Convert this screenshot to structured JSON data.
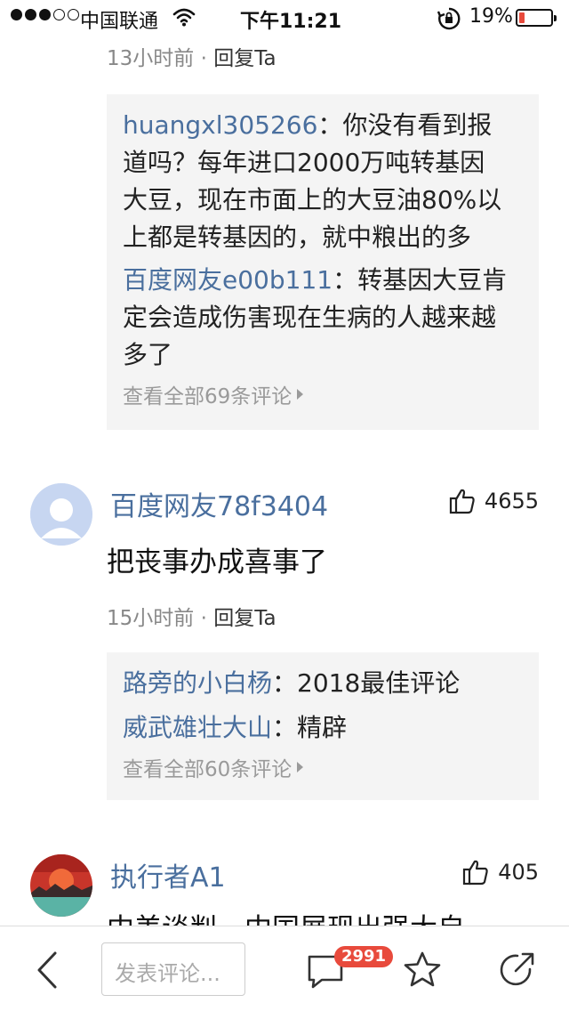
{
  "status_bar": {
    "carrier": "中国联通",
    "time": "下午11:21",
    "battery_percent": "19%",
    "battery_level": 0.19,
    "signal_bars_filled": 3,
    "signal_bars_total": 5
  },
  "colors": {
    "username": "#4a6f9e",
    "badge": "#e84a3c",
    "reply_box_bg": "#f4f4f4"
  },
  "top_item": {
    "time": "13小时前",
    "separator": "·",
    "reply_label": "回复Ta",
    "replies": [
      {
        "name": "huangxl305266",
        "sep": "：",
        "lines": [
          "你没有看到报",
          "道吗？每年进口2000万吨转基因",
          "大豆，现在市面上的大豆油80%以",
          "上都是转基因的，就中粮出的多"
        ]
      },
      {
        "name": "百度网友e00b111",
        "sep": "：",
        "lines": [
          "转基因大豆肯",
          "定会造成伤害现在生病的人越来越",
          "多了"
        ]
      }
    ],
    "view_all": "查看全部69条评论"
  },
  "comment1": {
    "username": "百度网友78f3404",
    "likes": "4655",
    "text": "把丧事办成喜事了",
    "time": "15小时前",
    "separator": "·",
    "reply_label": "回复Ta",
    "replies": [
      {
        "name": "路旁的小白杨",
        "sep": "：",
        "text": "2018最佳评论"
      },
      {
        "name": "威武雄壮大山",
        "sep": "：",
        "text": "精辟"
      }
    ],
    "view_all": "查看全部60条评论"
  },
  "comment2": {
    "username": "执行者A1",
    "likes": "405",
    "text": "中美谈判，中国展现出强大自"
  },
  "bottom_bar": {
    "input_placeholder": "发表评论...",
    "comment_count": "2991",
    "icons": [
      "back-arrow-icon",
      "chat-bubble-icon",
      "star-icon",
      "share-icon"
    ]
  }
}
